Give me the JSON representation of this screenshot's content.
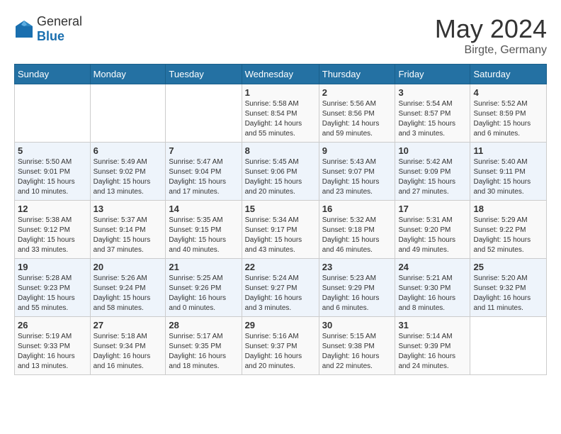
{
  "header": {
    "logo": {
      "general": "General",
      "blue": "Blue"
    },
    "title": "May 2024",
    "location": "Birgte, Germany"
  },
  "weekdays": [
    "Sunday",
    "Monday",
    "Tuesday",
    "Wednesday",
    "Thursday",
    "Friday",
    "Saturday"
  ],
  "weeks": [
    [
      {
        "day": "",
        "info": ""
      },
      {
        "day": "",
        "info": ""
      },
      {
        "day": "",
        "info": ""
      },
      {
        "day": "1",
        "info": "Sunrise: 5:58 AM\nSunset: 8:54 PM\nDaylight: 14 hours\nand 55 minutes."
      },
      {
        "day": "2",
        "info": "Sunrise: 5:56 AM\nSunset: 8:56 PM\nDaylight: 14 hours\nand 59 minutes."
      },
      {
        "day": "3",
        "info": "Sunrise: 5:54 AM\nSunset: 8:57 PM\nDaylight: 15 hours\nand 3 minutes."
      },
      {
        "day": "4",
        "info": "Sunrise: 5:52 AM\nSunset: 8:59 PM\nDaylight: 15 hours\nand 6 minutes."
      }
    ],
    [
      {
        "day": "5",
        "info": "Sunrise: 5:50 AM\nSunset: 9:01 PM\nDaylight: 15 hours\nand 10 minutes."
      },
      {
        "day": "6",
        "info": "Sunrise: 5:49 AM\nSunset: 9:02 PM\nDaylight: 15 hours\nand 13 minutes."
      },
      {
        "day": "7",
        "info": "Sunrise: 5:47 AM\nSunset: 9:04 PM\nDaylight: 15 hours\nand 17 minutes."
      },
      {
        "day": "8",
        "info": "Sunrise: 5:45 AM\nSunset: 9:06 PM\nDaylight: 15 hours\nand 20 minutes."
      },
      {
        "day": "9",
        "info": "Sunrise: 5:43 AM\nSunset: 9:07 PM\nDaylight: 15 hours\nand 23 minutes."
      },
      {
        "day": "10",
        "info": "Sunrise: 5:42 AM\nSunset: 9:09 PM\nDaylight: 15 hours\nand 27 minutes."
      },
      {
        "day": "11",
        "info": "Sunrise: 5:40 AM\nSunset: 9:11 PM\nDaylight: 15 hours\nand 30 minutes."
      }
    ],
    [
      {
        "day": "12",
        "info": "Sunrise: 5:38 AM\nSunset: 9:12 PM\nDaylight: 15 hours\nand 33 minutes."
      },
      {
        "day": "13",
        "info": "Sunrise: 5:37 AM\nSunset: 9:14 PM\nDaylight: 15 hours\nand 37 minutes."
      },
      {
        "day": "14",
        "info": "Sunrise: 5:35 AM\nSunset: 9:15 PM\nDaylight: 15 hours\nand 40 minutes."
      },
      {
        "day": "15",
        "info": "Sunrise: 5:34 AM\nSunset: 9:17 PM\nDaylight: 15 hours\nand 43 minutes."
      },
      {
        "day": "16",
        "info": "Sunrise: 5:32 AM\nSunset: 9:18 PM\nDaylight: 15 hours\nand 46 minutes."
      },
      {
        "day": "17",
        "info": "Sunrise: 5:31 AM\nSunset: 9:20 PM\nDaylight: 15 hours\nand 49 minutes."
      },
      {
        "day": "18",
        "info": "Sunrise: 5:29 AM\nSunset: 9:22 PM\nDaylight: 15 hours\nand 52 minutes."
      }
    ],
    [
      {
        "day": "19",
        "info": "Sunrise: 5:28 AM\nSunset: 9:23 PM\nDaylight: 15 hours\nand 55 minutes."
      },
      {
        "day": "20",
        "info": "Sunrise: 5:26 AM\nSunset: 9:24 PM\nDaylight: 15 hours\nand 58 minutes."
      },
      {
        "day": "21",
        "info": "Sunrise: 5:25 AM\nSunset: 9:26 PM\nDaylight: 16 hours\nand 0 minutes."
      },
      {
        "day": "22",
        "info": "Sunrise: 5:24 AM\nSunset: 9:27 PM\nDaylight: 16 hours\nand 3 minutes."
      },
      {
        "day": "23",
        "info": "Sunrise: 5:23 AM\nSunset: 9:29 PM\nDaylight: 16 hours\nand 6 minutes."
      },
      {
        "day": "24",
        "info": "Sunrise: 5:21 AM\nSunset: 9:30 PM\nDaylight: 16 hours\nand 8 minutes."
      },
      {
        "day": "25",
        "info": "Sunrise: 5:20 AM\nSunset: 9:32 PM\nDaylight: 16 hours\nand 11 minutes."
      }
    ],
    [
      {
        "day": "26",
        "info": "Sunrise: 5:19 AM\nSunset: 9:33 PM\nDaylight: 16 hours\nand 13 minutes."
      },
      {
        "day": "27",
        "info": "Sunrise: 5:18 AM\nSunset: 9:34 PM\nDaylight: 16 hours\nand 16 minutes."
      },
      {
        "day": "28",
        "info": "Sunrise: 5:17 AM\nSunset: 9:35 PM\nDaylight: 16 hours\nand 18 minutes."
      },
      {
        "day": "29",
        "info": "Sunrise: 5:16 AM\nSunset: 9:37 PM\nDaylight: 16 hours\nand 20 minutes."
      },
      {
        "day": "30",
        "info": "Sunrise: 5:15 AM\nSunset: 9:38 PM\nDaylight: 16 hours\nand 22 minutes."
      },
      {
        "day": "31",
        "info": "Sunrise: 5:14 AM\nSunset: 9:39 PM\nDaylight: 16 hours\nand 24 minutes."
      },
      {
        "day": "",
        "info": ""
      }
    ]
  ]
}
